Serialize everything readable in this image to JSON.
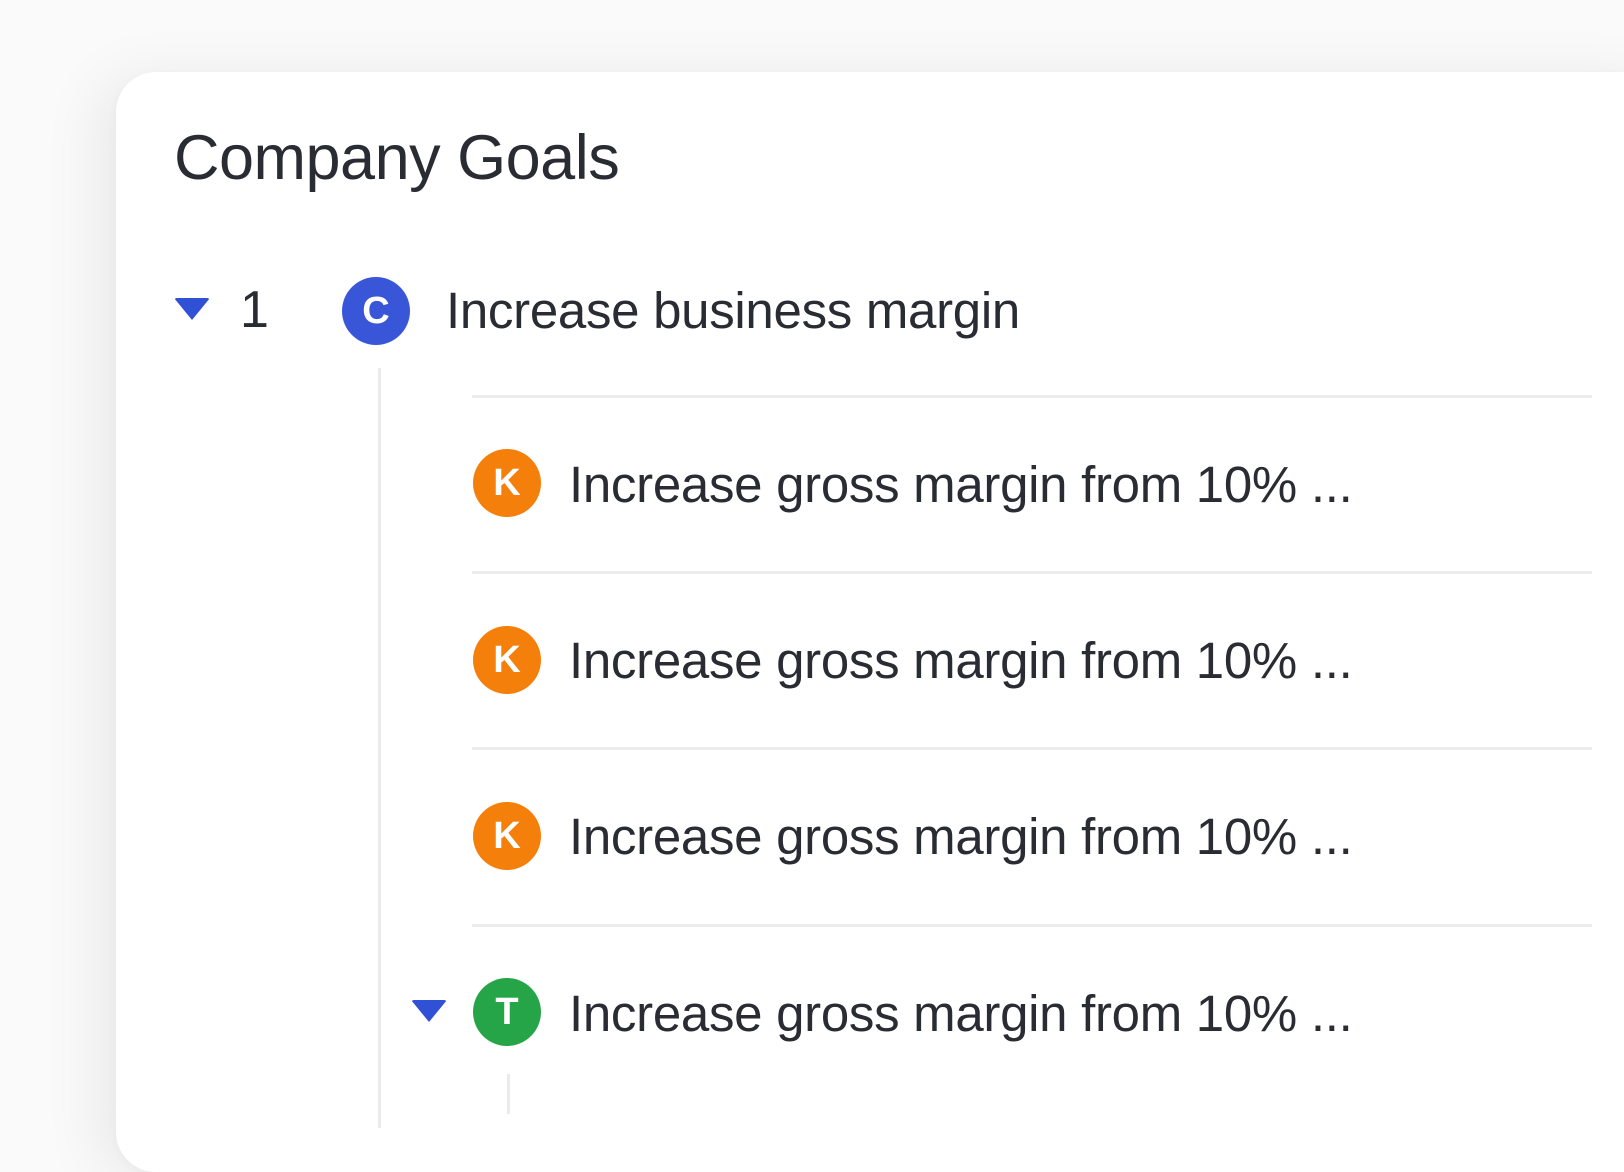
{
  "header": {
    "title": "Company Goals"
  },
  "goal": {
    "number": "1",
    "badge": "C",
    "badge_color": "#3a56d8",
    "label": "Increase business margin",
    "expanded": true
  },
  "key_results": [
    {
      "badge": "K",
      "badge_color": "#f57f0b",
      "label": "Increase gross margin from 10% ..."
    },
    {
      "badge": "K",
      "badge_color": "#f57f0b",
      "label": "Increase gross margin from 10% ..."
    },
    {
      "badge": "K",
      "badge_color": "#f57f0b",
      "label": "Increase gross margin from 10% ..."
    },
    {
      "badge": "T",
      "badge_color": "#25a548",
      "label": "Increase gross margin from 10% ...",
      "expanded": true
    }
  ],
  "colors": {
    "accent": "#3050d6",
    "text": "#2a2c34",
    "divider": "#ececec"
  },
  "icons": {
    "expand": "caret-down-icon"
  }
}
